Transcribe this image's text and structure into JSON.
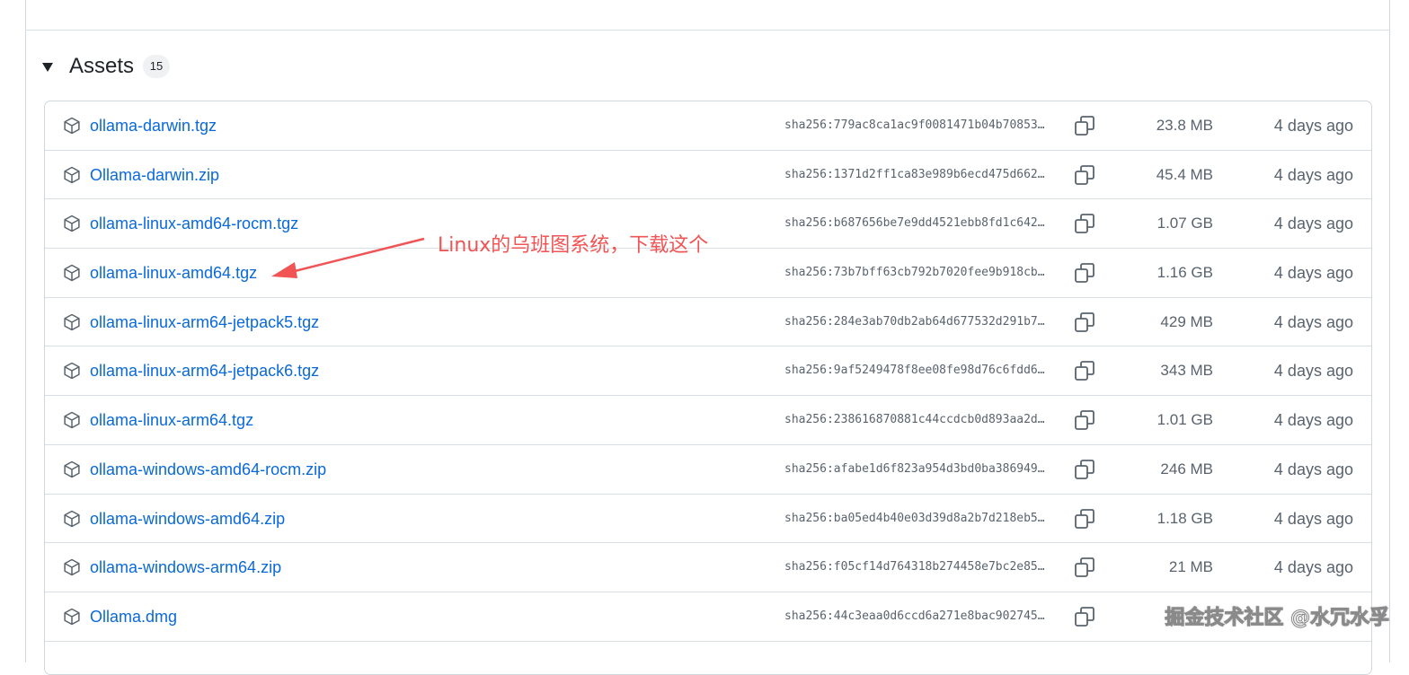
{
  "assets": {
    "title": "Assets",
    "count": "15",
    "items": [
      {
        "name": "ollama-darwin.tgz",
        "sha": "sha256:779ac8ca1ac9f0081471b04b70853…",
        "size": "23.8 MB",
        "date": "4 days ago"
      },
      {
        "name": "Ollama-darwin.zip",
        "sha": "sha256:1371d2ff1ca83e989b6ecd475d662…",
        "size": "45.4 MB",
        "date": "4 days ago"
      },
      {
        "name": "ollama-linux-amd64-rocm.tgz",
        "sha": "sha256:b687656be7e9dd4521ebb8fd1c642…",
        "size": "1.07 GB",
        "date": "4 days ago"
      },
      {
        "name": "ollama-linux-amd64.tgz",
        "sha": "sha256:73b7bff63cb792b7020fee9b918cb…",
        "size": "1.16 GB",
        "date": "4 days ago"
      },
      {
        "name": "ollama-linux-arm64-jetpack5.tgz",
        "sha": "sha256:284e3ab70db2ab64d677532d291b7…",
        "size": "429 MB",
        "date": "4 days ago"
      },
      {
        "name": "ollama-linux-arm64-jetpack6.tgz",
        "sha": "sha256:9af5249478f8ee08fe98d76c6fdd6…",
        "size": "343 MB",
        "date": "4 days ago"
      },
      {
        "name": "ollama-linux-arm64.tgz",
        "sha": "sha256:238616870881c44ccdcb0d893aa2d…",
        "size": "1.01 GB",
        "date": "4 days ago"
      },
      {
        "name": "ollama-windows-amd64-rocm.zip",
        "sha": "sha256:afabe1d6f823a954d3bd0ba386949…",
        "size": "246 MB",
        "date": "4 days ago"
      },
      {
        "name": "ollama-windows-amd64.zip",
        "sha": "sha256:ba05ed4b40e03d39d8a2b7d218eb5…",
        "size": "1.18 GB",
        "date": "4 days ago"
      },
      {
        "name": "ollama-windows-arm64.zip",
        "sha": "sha256:f05cf14d764318b274458e7bc2e85…",
        "size": "21 MB",
        "date": "4 days ago"
      },
      {
        "name": "Ollama.dmg",
        "sha": "sha256:44c3eaa0d6ccd6a271e8bac902745…",
        "size": "",
        "date": ""
      }
    ]
  },
  "annotation": {
    "text": "Linux的乌班图系统，下载这个",
    "color": "#f05454"
  },
  "watermark": {
    "text": "掘金技术社区 @水冗水孚"
  },
  "colors": {
    "link": "#0969da",
    "muted": "#59636e",
    "border": "#d0d7de"
  },
  "icons": {
    "asset": "package-icon",
    "copy": "copy-icon",
    "toggle": "triangle-down-icon"
  }
}
